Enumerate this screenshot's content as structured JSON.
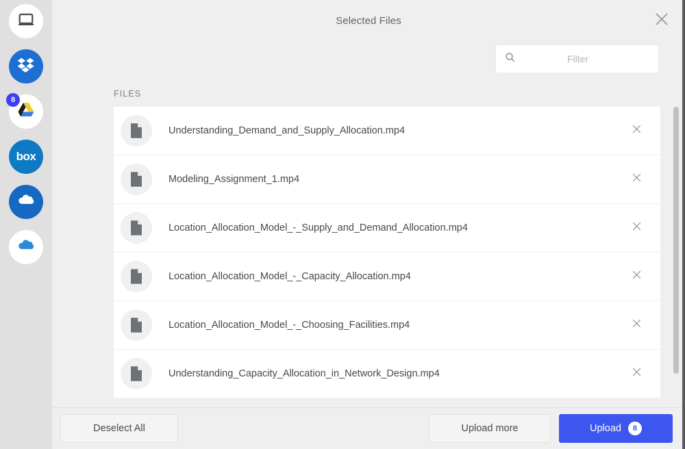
{
  "sidebar": {
    "sources": [
      {
        "name": "my-device",
        "icon": "laptop-icon",
        "badge": null
      },
      {
        "name": "dropbox",
        "icon": "dropbox-icon",
        "badge": null
      },
      {
        "name": "google-drive",
        "icon": "google-drive-icon",
        "badge": "8"
      },
      {
        "name": "box",
        "icon": "box-icon",
        "label": "box",
        "badge": null
      },
      {
        "name": "onedrive",
        "icon": "onedrive-icon",
        "badge": null
      },
      {
        "name": "onedrive-business",
        "icon": "onedrive-business-icon",
        "badge": null
      }
    ]
  },
  "header": {
    "title": "Selected Files",
    "close_icon": "close-icon"
  },
  "search": {
    "placeholder": "Filter",
    "value": "",
    "icon": "search-icon"
  },
  "list": {
    "section_label": "FILES",
    "files": [
      {
        "name": "Understanding_Demand_and_Supply_Allocation.mp4",
        "icon": "file-icon",
        "remove_icon": "close-icon"
      },
      {
        "name": "Modeling_Assignment_1.mp4",
        "icon": "file-icon",
        "remove_icon": "close-icon"
      },
      {
        "name": "Location_Allocation_Model_-_Supply_and_Demand_Allocation.mp4",
        "icon": "file-icon",
        "remove_icon": "close-icon"
      },
      {
        "name": "Location_Allocation_Model_-_Capacity_Allocation.mp4",
        "icon": "file-icon",
        "remove_icon": "close-icon"
      },
      {
        "name": "Location_Allocation_Model_-_Choosing_Facilities.mp4",
        "icon": "file-icon",
        "remove_icon": "close-icon"
      },
      {
        "name": "Understanding_Capacity_Allocation_in_Network_Design.mp4",
        "icon": "file-icon",
        "remove_icon": "close-icon"
      }
    ]
  },
  "footer": {
    "deselect_all_label": "Deselect All",
    "upload_more_label": "Upload more",
    "upload_label": "Upload",
    "upload_count": "8"
  },
  "colors": {
    "accent": "#3d56f0",
    "sidebar_bg": "#e0e0e0",
    "modal_bg": "#efeff0",
    "row_bg": "#ffffff",
    "badge_bg": "#3d3df5"
  }
}
